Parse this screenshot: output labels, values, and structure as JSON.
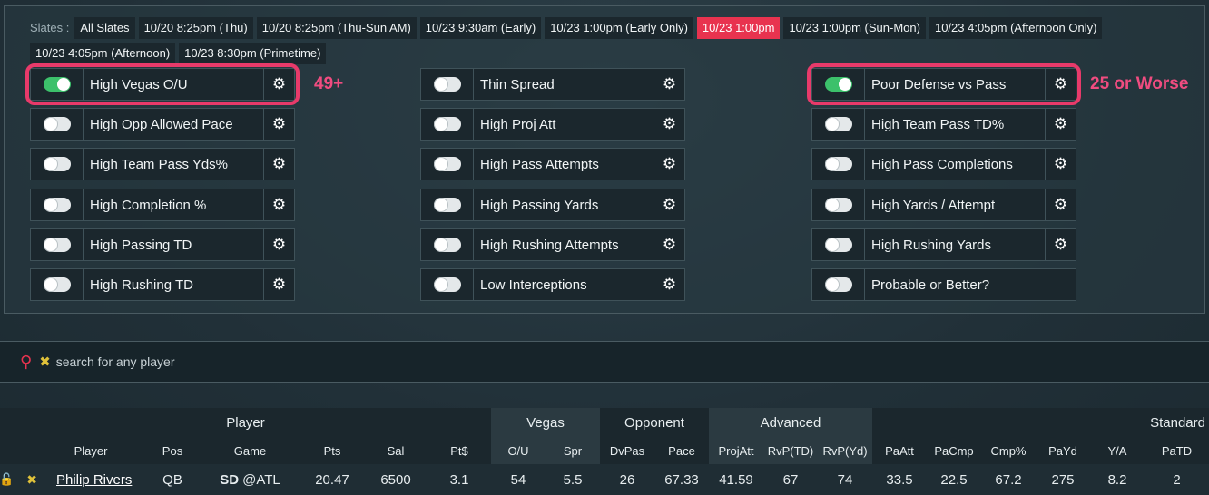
{
  "slates": {
    "label": "Slates :",
    "items": [
      {
        "label": "All Slates",
        "active": false
      },
      {
        "label": "10/20 8:25pm (Thu)",
        "active": false
      },
      {
        "label": "10/20 8:25pm (Thu-Sun AM)",
        "active": false
      },
      {
        "label": "10/23 9:30am (Early)",
        "active": false
      },
      {
        "label": "10/23 1:00pm (Early Only)",
        "active": false
      },
      {
        "label": "10/23 1:00pm",
        "active": true
      },
      {
        "label": "10/23 1:00pm (Sun-Mon)",
        "active": false
      },
      {
        "label": "10/23 4:05pm (Afternoon Only)",
        "active": false
      },
      {
        "label": "10/23 4:05pm (Afternoon)",
        "active": false
      },
      {
        "label": "10/23 8:30pm (Primetime)",
        "active": false
      }
    ]
  },
  "filters": {
    "col1": [
      {
        "label": "High Vegas O/U",
        "on": true,
        "gear": true
      },
      {
        "label": "High Opp Allowed Pace",
        "on": false,
        "gear": true
      },
      {
        "label": "High Team Pass Yds%",
        "on": false,
        "gear": true
      },
      {
        "label": "High Completion %",
        "on": false,
        "gear": true
      },
      {
        "label": "High Passing TD",
        "on": false,
        "gear": true
      },
      {
        "label": "High Rushing TD",
        "on": false,
        "gear": true
      }
    ],
    "col2": [
      {
        "label": "Thin Spread",
        "on": false,
        "gear": true
      },
      {
        "label": "High Proj Att",
        "on": false,
        "gear": true
      },
      {
        "label": "High Pass Attempts",
        "on": false,
        "gear": true
      },
      {
        "label": "High Passing Yards",
        "on": false,
        "gear": true
      },
      {
        "label": "High Rushing Attempts",
        "on": false,
        "gear": true
      },
      {
        "label": "Low Interceptions",
        "on": false,
        "gear": true
      }
    ],
    "col3": [
      {
        "label": "Poor Defense vs Pass",
        "on": true,
        "gear": true
      },
      {
        "label": "High Team Pass TD%",
        "on": false,
        "gear": true
      },
      {
        "label": "High Pass Completions",
        "on": false,
        "gear": true
      },
      {
        "label": "High Yards / Attempt",
        "on": false,
        "gear": true
      },
      {
        "label": "High Rushing Yards",
        "on": false,
        "gear": true
      },
      {
        "label": "Probable or Better?",
        "on": false,
        "gear": false
      }
    ]
  },
  "annotations": {
    "vegas_note": "49+",
    "defense_note": "25 or Worse"
  },
  "colors": {
    "accent": "#e8334f",
    "toggle_on": "#3cc16b",
    "annotation": "#e83a6a"
  },
  "search": {
    "placeholder": "search for any player"
  },
  "table": {
    "groups": [
      "Player",
      "Vegas",
      "Opponent",
      "Advanced",
      "Standard"
    ],
    "headers": [
      "Player",
      "Pos",
      "Game",
      "Pts",
      "Sal",
      "Pt$",
      "O/U",
      "Spr",
      "DvPas",
      "Pace",
      "ProjAtt",
      "RvP(TD)",
      "RvP(Yd)",
      "PaAtt",
      "PaCmp",
      "Cmp%",
      "PaYd",
      "Y/A",
      "PaTD"
    ],
    "rows": [
      {
        "player": "Philip Rivers",
        "pos": "QB",
        "team": "SD",
        "opp": "@ATL",
        "values": [
          "20.47",
          "6500",
          "3.1",
          "54",
          "5.5",
          "26",
          "67.33",
          "41.59",
          "67",
          "74",
          "33.5",
          "22.5",
          "67.2",
          "275",
          "8.2",
          "2"
        ]
      }
    ]
  }
}
